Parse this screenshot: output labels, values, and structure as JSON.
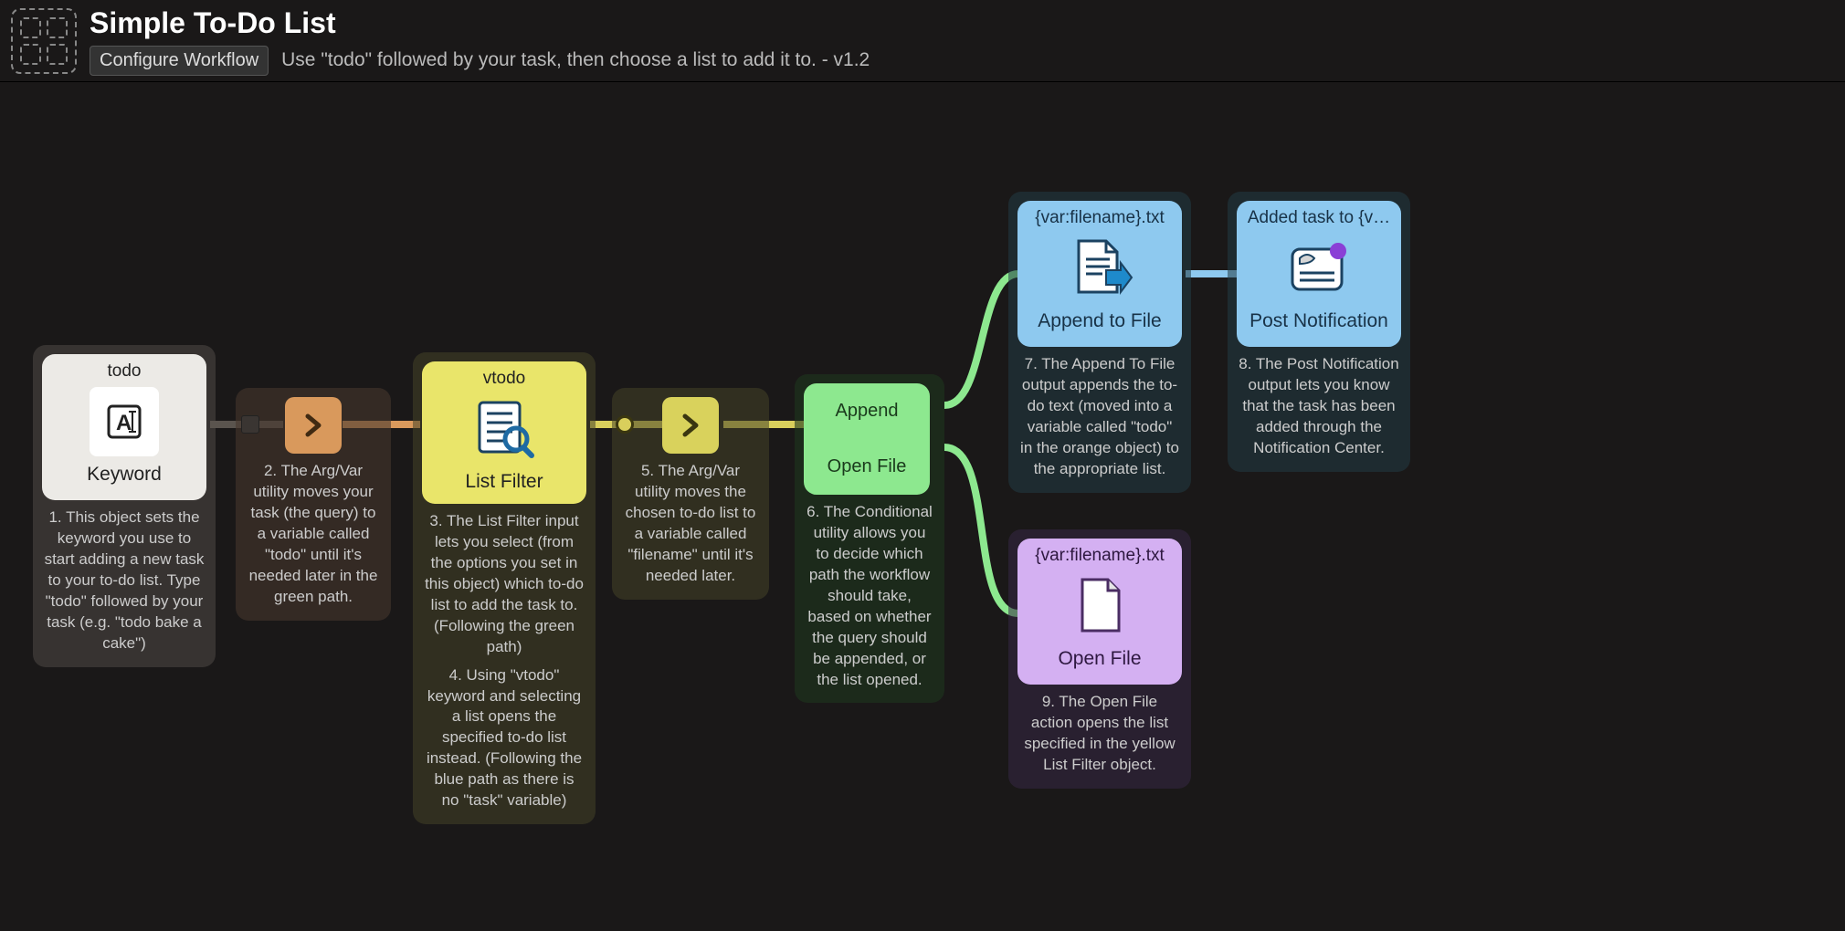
{
  "header": {
    "title": "Simple To-Do List",
    "configure_label": "Configure Workflow",
    "description": "Use \"todo\" followed by your task, then choose a list to add it to. - v1.2"
  },
  "nodes": {
    "keyword": {
      "title": "todo",
      "type": "Keyword",
      "desc": "1. This object sets the keyword you use to start adding a new task to your to-do list. Type \"todo\" followed by your task (e.g. \"todo bake a cake\")"
    },
    "argvar1": {
      "desc": "2. The Arg/Var utility moves your task (the query) to a variable called \"todo\" until it's needed later in the green path."
    },
    "listfilter": {
      "title": "vtodo",
      "type": "List Filter",
      "desc1": "3. The List Filter input lets you select (from the options you set in this object) which to-do list to add the task to. (Following the green path)",
      "desc2": "4. Using \"vtodo\" keyword and selecting a list opens the specified to-do list instead. (Following the blue path as there is no \"task\" variable)"
    },
    "argvar2": {
      "desc": "5. The Arg/Var utility moves the chosen to-do list to a variable called \"filename\" until it's needed later."
    },
    "conditional": {
      "opt1": "Append",
      "opt2": "Open File",
      "desc": "6. The Conditional utility allows you to decide which path the workflow should take, based on whether the query should be appended, or the list opened."
    },
    "append": {
      "title": "{var:filename}.txt",
      "type": "Append to File",
      "desc": "7. The Append To File output appends the to-do text (moved into a variable called \"todo\" in the orange object) to the appropriate list."
    },
    "notify": {
      "title": "Added task to {v…",
      "type": "Post Notification",
      "desc": "8. The Post Notification output lets you know that the task has been added through the Notification Center."
    },
    "openfile": {
      "title": "{var:filename}.txt",
      "type": "Open File",
      "desc": "9. The Open File action opens the list specified in the yellow List Filter object."
    }
  }
}
